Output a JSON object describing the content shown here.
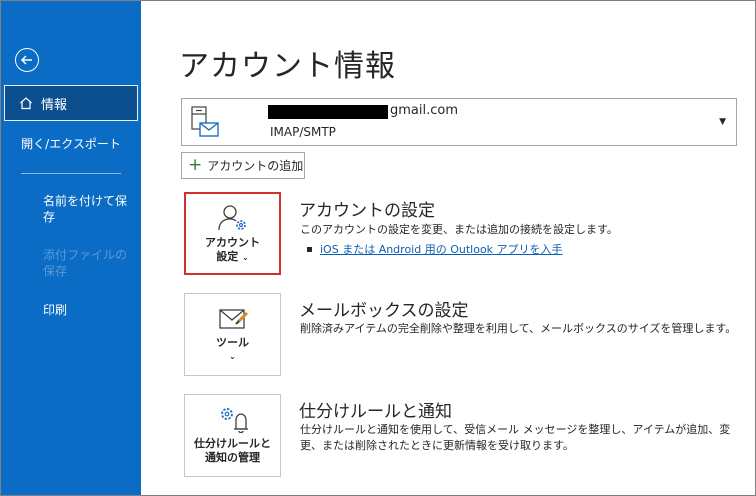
{
  "sidebar": {
    "info_label": "情報",
    "open_export_label": "開く/エクスポート",
    "save_as_label": "名前を付けて保存",
    "save_attachments_label": "添付ファイルの保存",
    "print_label": "印刷"
  },
  "main": {
    "title": "アカウント情報",
    "account": {
      "email_suffix": "gmail.com",
      "type": "IMAP/SMTP"
    },
    "add_account_label": "アカウントの追加",
    "sections": [
      {
        "tile_label_line1": "アカウント",
        "tile_label_line2": "設定",
        "title": "アカウントの設定",
        "description": "このアカウントの設定を変更、または追加の接続を設定します。",
        "link": "iOS または Android 用の Outlook アプリを入手"
      },
      {
        "tile_label": "ツール",
        "title": "メールボックスの設定",
        "description": "削除済みアイテムの完全削除や整理を利用して、メールボックスのサイズを管理します。"
      },
      {
        "tile_label_line1": "仕分けルールと",
        "tile_label_line2": "通知の管理",
        "title": "仕分けルールと通知",
        "description": "仕分けルールと通知を使用して、受信メール メッセージを整理し、アイテムが追加、変更、または削除されたときに更新情報を受け取ります。"
      }
    ]
  },
  "colors": {
    "sidebar": "#0a6cc4",
    "sidebar_selected": "#0b4f8f",
    "link": "#0a5fb4",
    "selected_tile_border": "#d32f2f"
  },
  "icons": [
    "back-arrow-icon",
    "home-icon",
    "mailbox-icon",
    "chevron-down-icon",
    "plus-icon",
    "account-settings-icon",
    "mail-tools-icon",
    "rules-alerts-icon"
  ]
}
